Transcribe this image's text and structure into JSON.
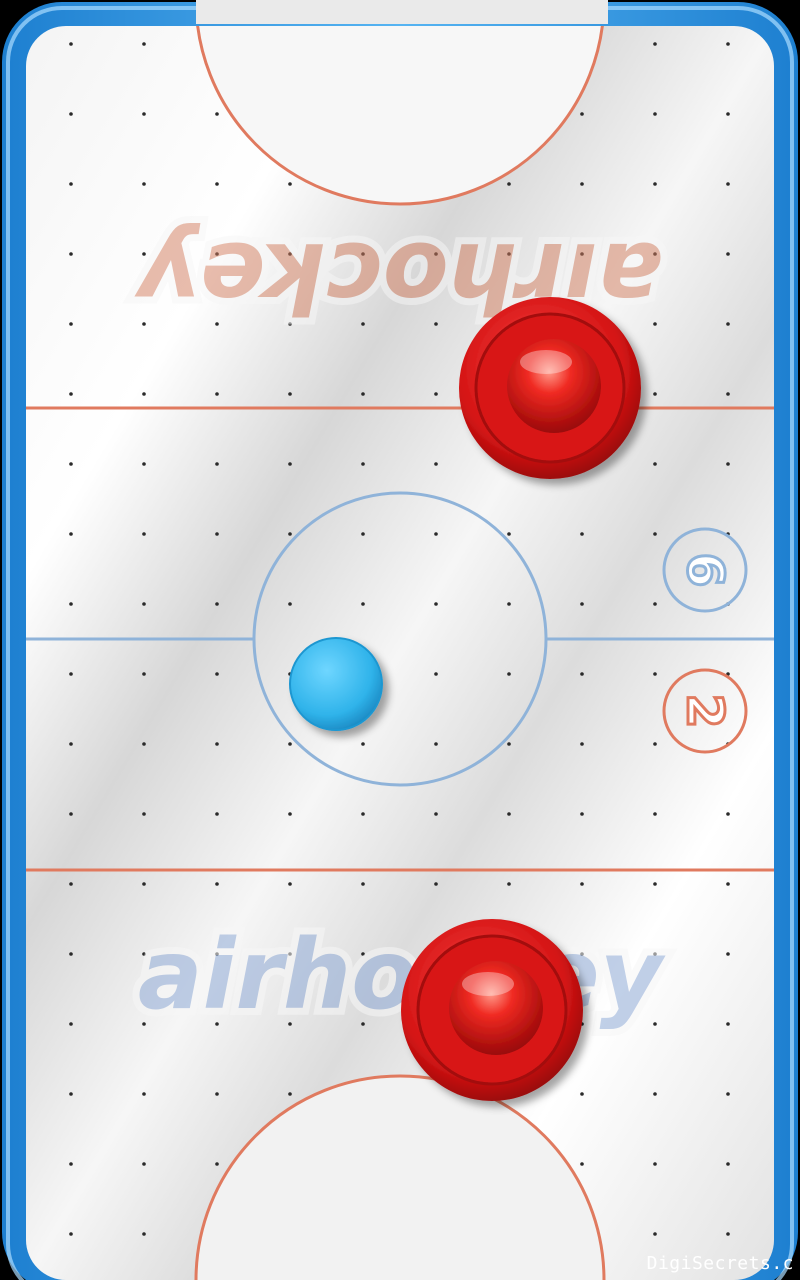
{
  "game": {
    "title_top": "airhockey",
    "title_bottom": "airhockey",
    "score_opponent": "6",
    "score_player": "2"
  },
  "watermark": "DigiSecrets.c",
  "colors": {
    "frame": "#3a9be0",
    "frame_light": "#8dd0ff",
    "surface": "#eeeeee",
    "red_line": "#e07a5f",
    "blue_line": "#8fb3d9",
    "mallet_red": "#e21c1c",
    "puck_blue": "#3cbcea"
  }
}
